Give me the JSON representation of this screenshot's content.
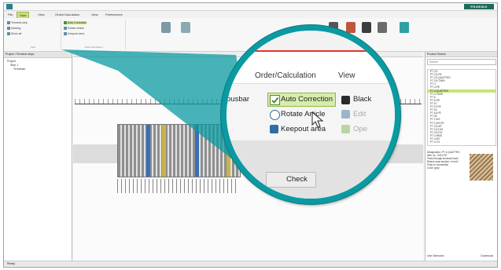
{
  "window": {
    "title": "",
    "brand": "PHOENIX",
    "status": "Ready"
  },
  "tabs": [
    "File",
    "Start",
    "View",
    "Order/Calculation",
    "View",
    "Preferences"
  ],
  "ribbon": {
    "groups": [
      {
        "items": [
          "Terminal strip",
          "Marking",
          "Show all"
        ],
        "label": "View"
      },
      {
        "items": [
          "Auto Correction",
          "Rotate Article",
          "Keepout area"
        ],
        "label": "Order/Calculation"
      }
    ]
  },
  "left_panel": {
    "header": "Project / Terminal strips",
    "tree": [
      "Project",
      "Strip 1",
      "Terminals"
    ]
  },
  "magnifier": {
    "menu": [
      "Order/Calculation",
      "View"
    ],
    "left_label": "busbar",
    "items": [
      {
        "label": "Auto Correction",
        "icon": "check-icon",
        "selected": true
      },
      {
        "label": "Rotate Article",
        "icon": "rotate-icon"
      },
      {
        "label": "Keepout area",
        "icon": "keepout-icon"
      }
    ],
    "right_items": [
      {
        "label": "Black",
        "icon": "black-square-icon"
      },
      {
        "label": "Edit",
        "icon": "edit-icon"
      },
      {
        "label": "Ope",
        "icon": "open-icon"
      }
    ],
    "check_label": "Check"
  },
  "right_panel": {
    "header": "Product Search",
    "search_placeholder": "Search",
    "list": [
      "PT 2,5",
      "PT 2,5-PE",
      "PT 2,5-QUATTRO",
      "PT 2,5-TWIN",
      "PT 4",
      "PT 4-PE",
      "PT 4-QUATTRO",
      "PT 4-TWIN",
      "PT 6",
      "PT 6-PE",
      "PT 10",
      "PT 10-PE",
      "PT 16",
      "PT 16-PE",
      "PT 35",
      "PT 1,5/S",
      "PT 1,5/S-PE",
      "PT 2,5-MT",
      "PT 2,5-DIO",
      "PT 2,5-FSI",
      "PT 4-HESI",
      "PT 4-MT",
      "PT 4-TG"
    ],
    "selected_index": 6,
    "detail_lines": [
      "Designation: PT 4-QUATTRO",
      "Item no.: 3211797",
      "Feed-through terminal block",
      "Rated cross section: 4 mm2",
      "Push-in connection",
      "Color: gray"
    ],
    "buttons": [
      "Use Selection",
      "Download"
    ]
  },
  "colors": {
    "accent": "#0b9aa1",
    "highlight": "#c9e27c",
    "red_line": "#e0342c"
  }
}
